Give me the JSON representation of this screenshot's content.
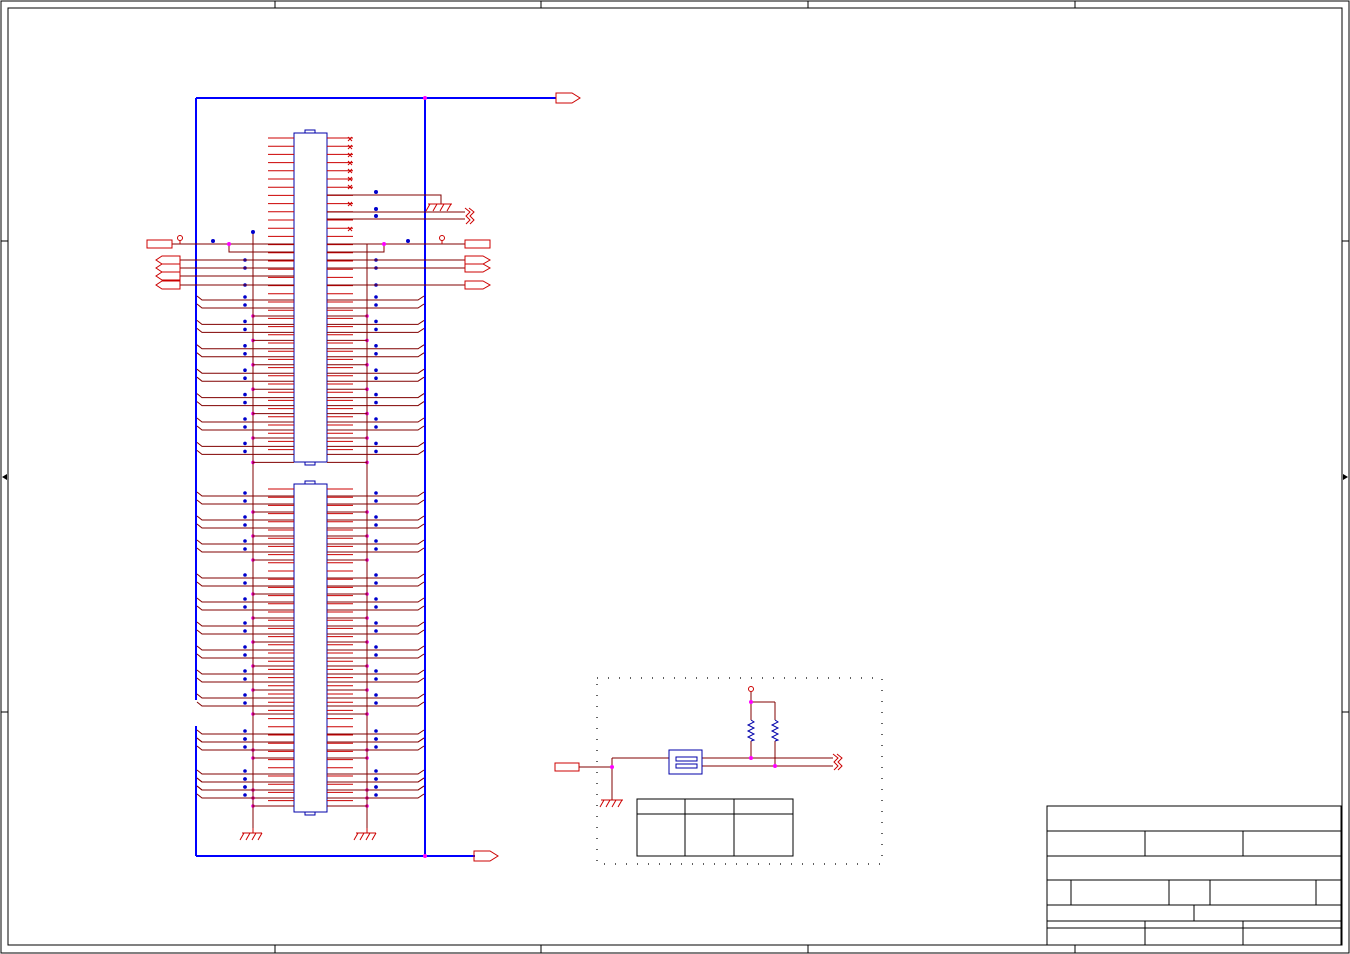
{
  "colors": {
    "background": "#ffffff",
    "frame": "#000000",
    "bus": "#0000ff",
    "net": "#800000",
    "pin": "#cc0000",
    "port": "#cc0000",
    "junction": "#ff00ff",
    "via": "#0000cc",
    "component_outline": "#0000aa",
    "annotation_box": "#000000"
  },
  "sheet": {
    "title_block": {
      "title": "",
      "project": "",
      "company": "",
      "size": "",
      "document_number": "",
      "revision": "",
      "date": "",
      "sheet": "",
      "drawn_by": "",
      "checked_by": "",
      "approved_by": ""
    }
  },
  "subcircuit": {
    "table": {
      "headers": [
        "",
        "",
        ""
      ],
      "rows": [
        [
          "",
          "",
          ""
        ]
      ]
    }
  }
}
